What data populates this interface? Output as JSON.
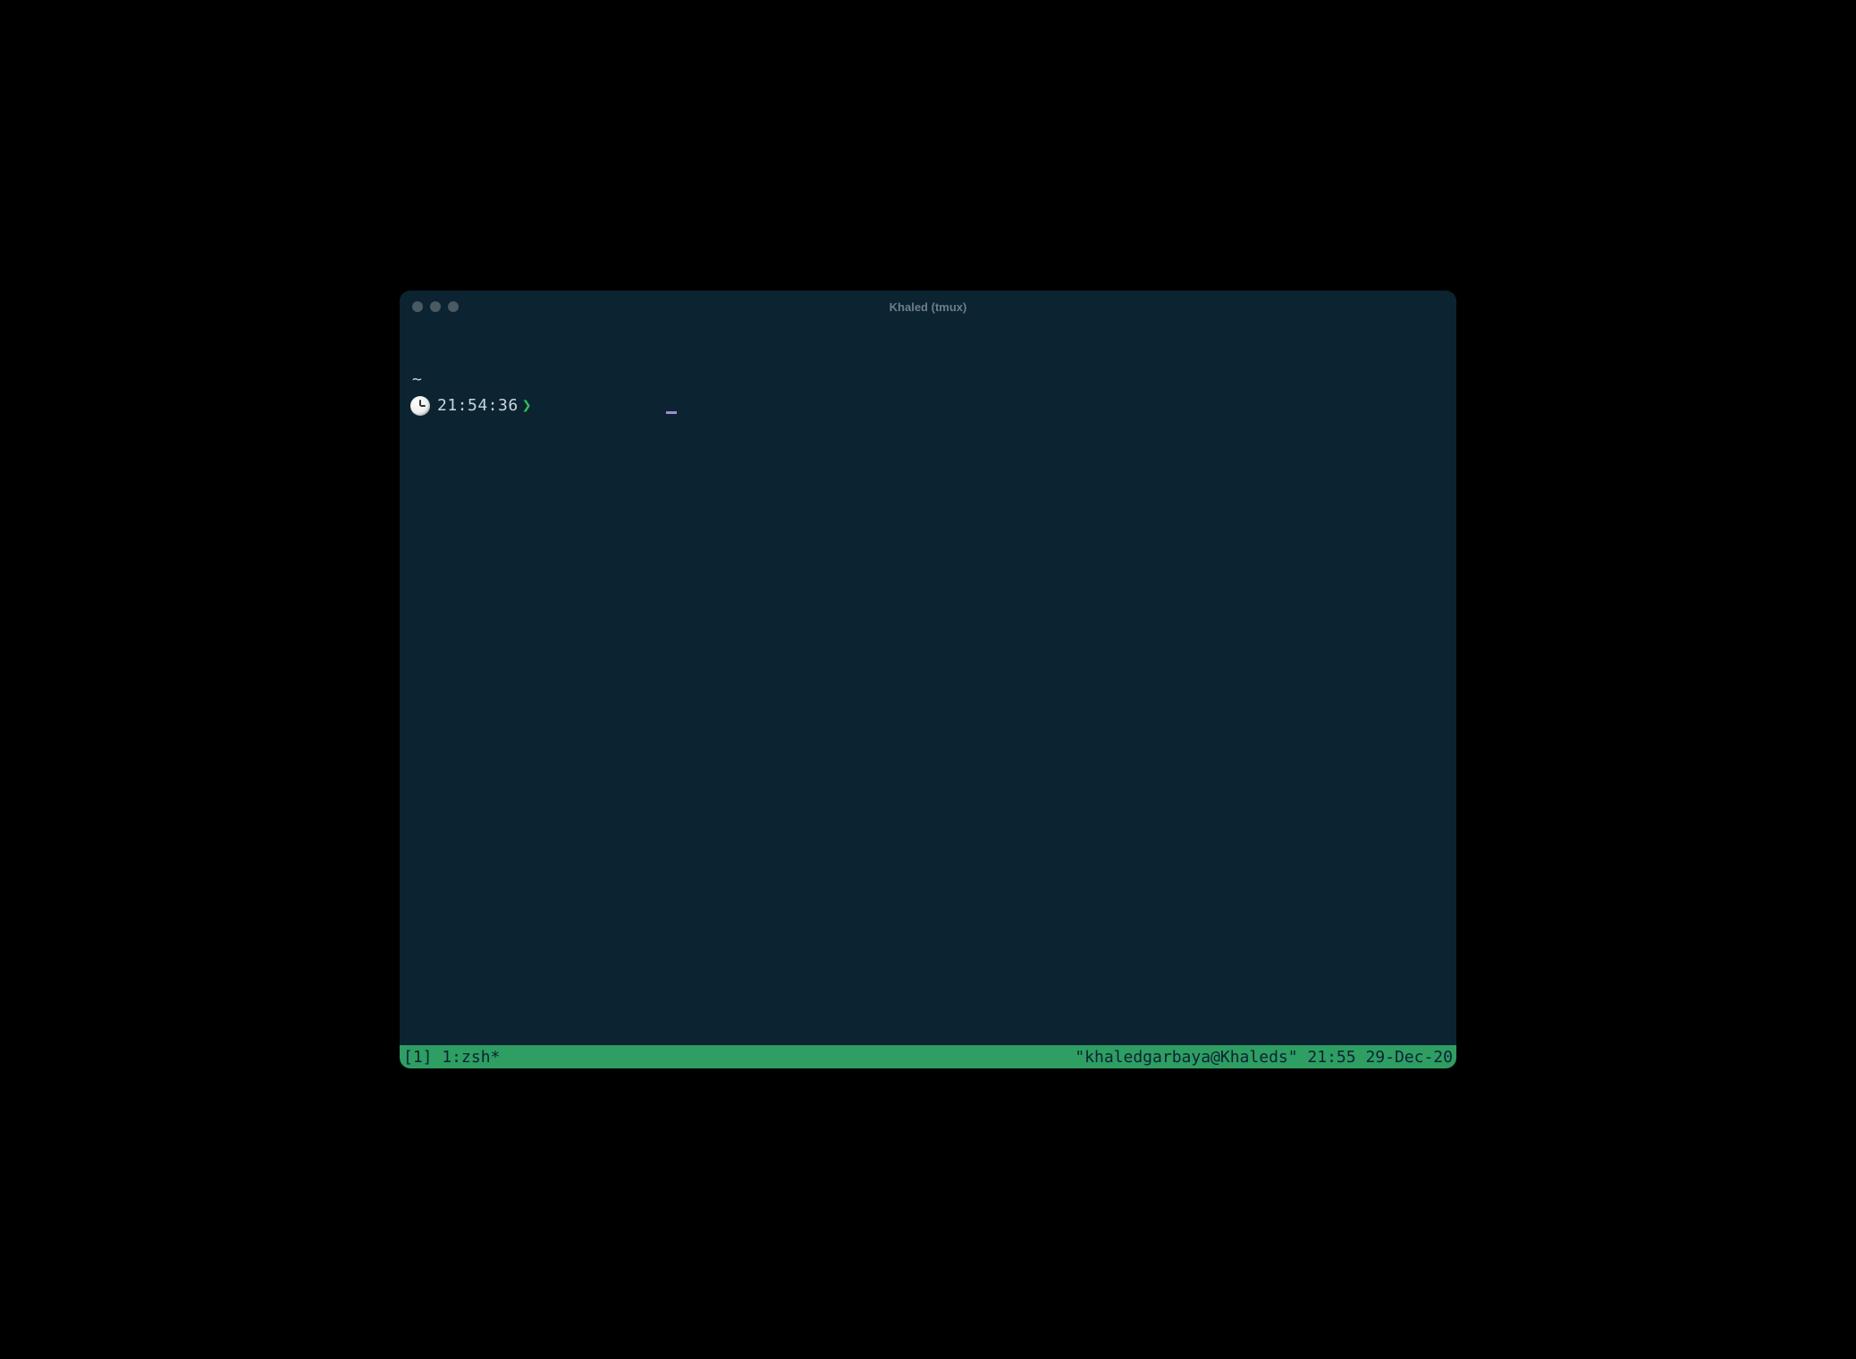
{
  "window": {
    "title": "Khaled (tmux)"
  },
  "prompt": {
    "cwd_symbol": "~",
    "clock_icon_name": "clock-10-icon",
    "time": "21:54:36",
    "arrow": "❯"
  },
  "statusbar": {
    "left": "[1] 1:zsh*",
    "right_host": "\"khaledgarbaya@Khaleds\"",
    "right_time": "21:55",
    "right_date": "29-Dec-20"
  },
  "colors": {
    "background": "#0c2331",
    "statusbar_bg": "#2e9e63",
    "prompt_arrow": "#2dbf5a",
    "cursor": "#a388d8"
  }
}
